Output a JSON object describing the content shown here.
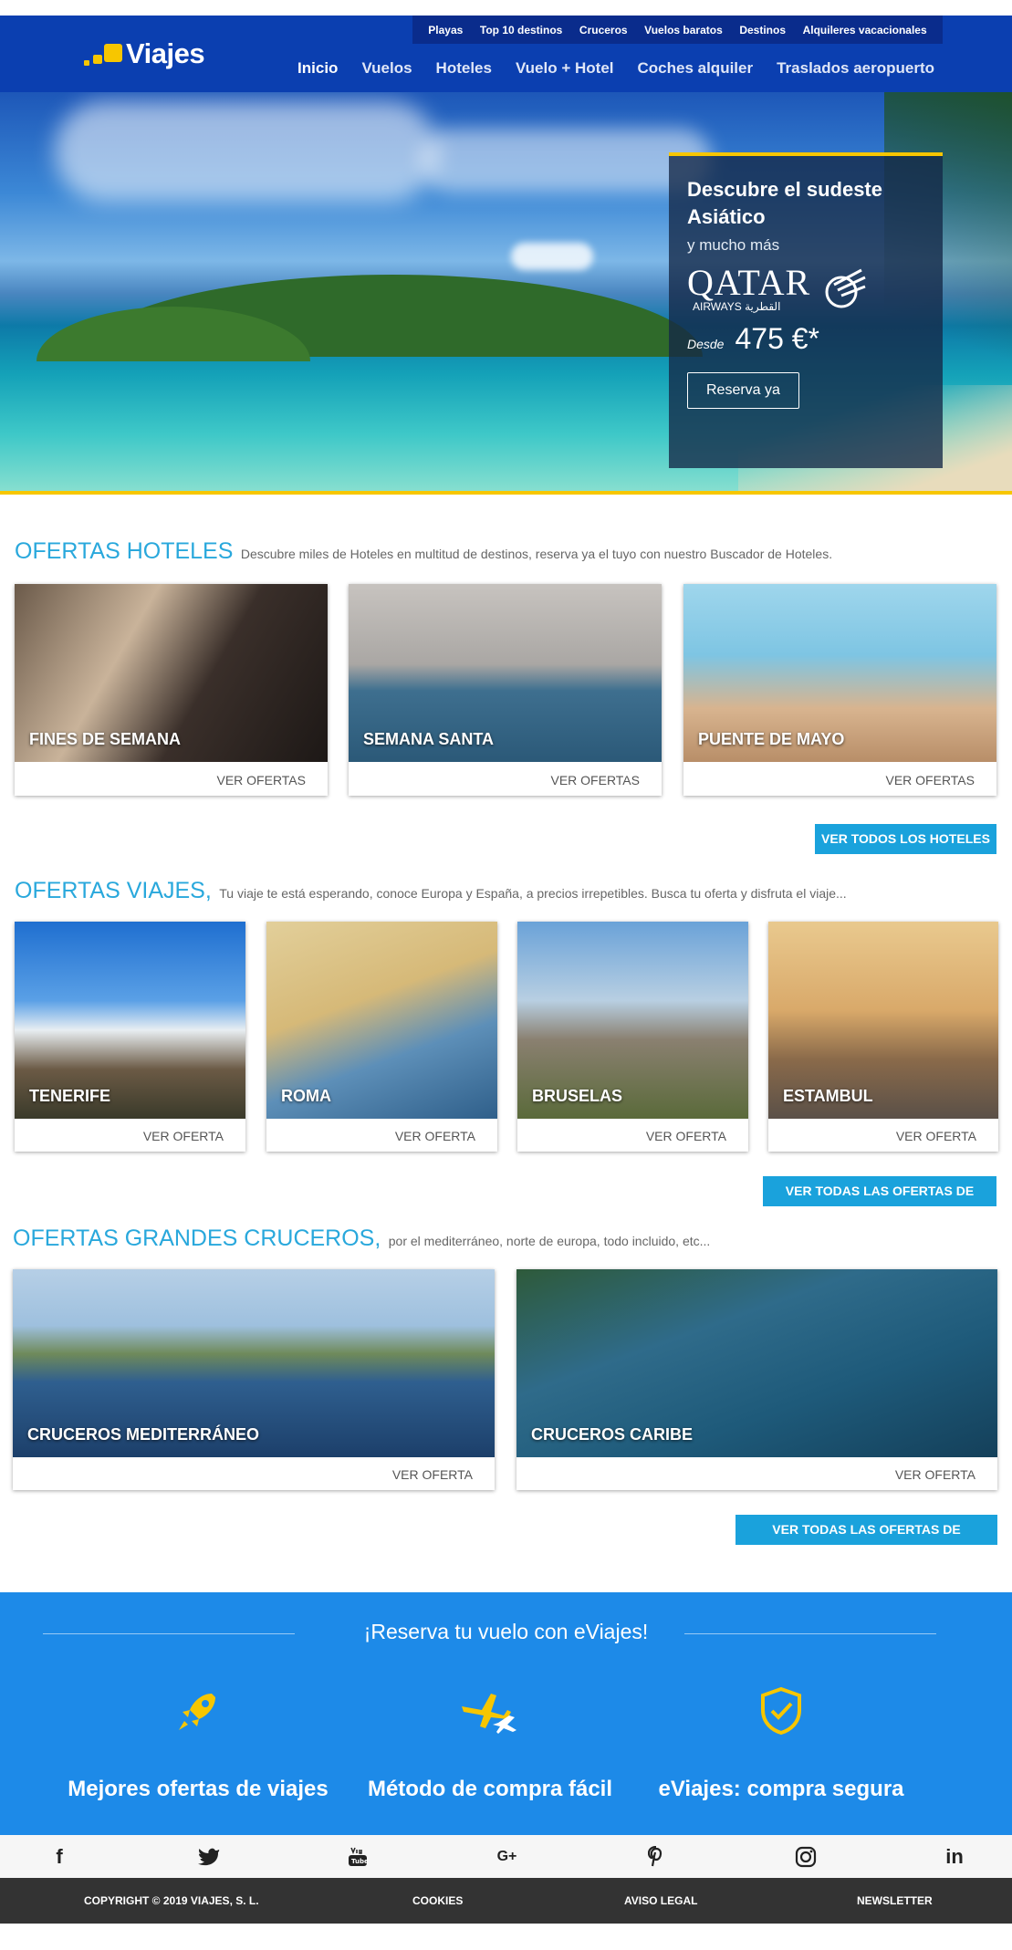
{
  "brand": {
    "name": "Viajes",
    "accent": "#f7c600",
    "header_bg": "#0b3fb0"
  },
  "topnav": [
    "Playas",
    "Top 10 destinos",
    "Cruceros",
    "Vuelos baratos",
    "Destinos",
    "Alquileres vacacionales"
  ],
  "mainnav": [
    "Inicio",
    "Vuelos",
    "Hoteles",
    "Vuelo + Hotel",
    "Coches alquiler",
    "Traslados aeropuerto"
  ],
  "promo": {
    "title": "Descubre el sudeste Asiático",
    "subtitle": "y mucho más",
    "airline": "QATAR",
    "airline_sub": "AIRWAYS القطرية",
    "desde": "Desde",
    "price": "475 €*",
    "button": "Reserva ya"
  },
  "hoteles": {
    "title": "OFERTAS HOTELES",
    "desc": "Descubre miles de Hoteles en multitud de destinos, reserva ya el tuyo con nuestro Buscador de Hoteles.",
    "cards": [
      {
        "label": "FINES DE SEMANA",
        "cta": "VER OFERTAS"
      },
      {
        "label": "SEMANA SANTA",
        "cta": "VER OFERTAS"
      },
      {
        "label": "PUENTE DE MAYO",
        "cta": "VER OFERTAS"
      }
    ],
    "all_button": "VER TODOS LOS HOTELES"
  },
  "viajes": {
    "title": "OFERTAS VIAJES,",
    "desc": "Tu viaje te está esperando, conoce Europa y España, a precios irrepetibles. Busca tu oferta y disfruta el viaje...",
    "cards": [
      {
        "label": "TENERIFE",
        "cta": "VER OFERTA"
      },
      {
        "label": "ROMA",
        "cta": "VER OFERTA"
      },
      {
        "label": "BRUSELAS",
        "cta": "VER OFERTA"
      },
      {
        "label": "ESTAMBUL",
        "cta": "VER OFERTA"
      }
    ],
    "all_button": "VER TODAS LAS OFERTAS DE VIAJES"
  },
  "cruceros": {
    "title": "OFERTAS GRANDES CRUCEROS,",
    "desc": "por el mediterráneo, norte de europa, todo incluido, etc...",
    "cards": [
      {
        "label": "CRUCEROS MEDITERRÁNEO",
        "cta": "VER OFERTA"
      },
      {
        "label": "CRUCEROS CARIBE",
        "cta": "VER OFERTA"
      }
    ],
    "all_button": "VER TODAS LAS OFERTAS DE CRUCEROS"
  },
  "band": {
    "title": "¡Reserva tu vuelo con eViajes!",
    "features": [
      {
        "icon": "rocket-icon",
        "label": "Mejores ofertas de viajes"
      },
      {
        "icon": "planes-icon",
        "label": "Método de compra fácil"
      },
      {
        "icon": "shield-check-icon",
        "label": "eViajes: compra segura"
      }
    ]
  },
  "social": [
    "facebook-icon",
    "twitter-icon",
    "youtube-icon",
    "google-plus-icon",
    "pinterest-icon",
    "instagram-icon",
    "linkedin-icon"
  ],
  "footer": {
    "copyright": "COPYRIGHT © 2019 VIAJES, S. L.",
    "cookies": "COOKIES",
    "legal": "AVISO LEGAL",
    "newsletter": "NEWSLETTER"
  }
}
